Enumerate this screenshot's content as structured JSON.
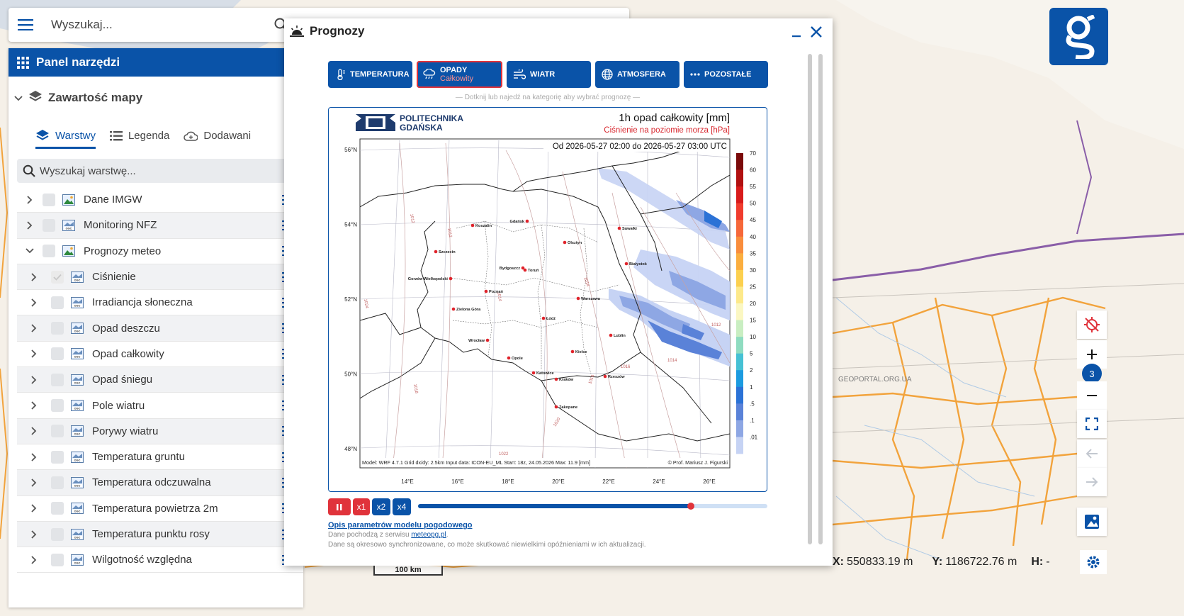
{
  "search": {
    "placeholder": "Wyszukaj..."
  },
  "tools_panel": {
    "title": "Panel narzędzi",
    "section_title": "Zawartość mapy",
    "tabs": [
      {
        "label": "Warstwy",
        "active": true
      },
      {
        "label": "Legenda",
        "active": false
      },
      {
        "label": "Dodawani",
        "active": false
      }
    ],
    "layer_search_placeholder": "Wyszukaj warstwę...",
    "layers": [
      {
        "name": "Dane IMGW",
        "level": 0
      },
      {
        "name": "Monitoring NFZ",
        "level": 0
      },
      {
        "name": "Prognozy meteo",
        "level": 0,
        "expanded": true
      },
      {
        "name": "Ciśnienie",
        "level": 1
      },
      {
        "name": "Irradiancja słoneczna",
        "level": 1
      },
      {
        "name": "Opad deszczu",
        "level": 1
      },
      {
        "name": "Opad całkowity",
        "level": 1
      },
      {
        "name": "Opad śniegu",
        "level": 1
      },
      {
        "name": "Pole wiatru",
        "level": 1
      },
      {
        "name": "Porywy wiatru",
        "level": 1
      },
      {
        "name": "Temperatura gruntu",
        "level": 1
      },
      {
        "name": "Temperatura odczuwalna",
        "level": 1
      },
      {
        "name": "Temperatura powietrza 2m",
        "level": 1
      },
      {
        "name": "Temperatura punktu rosy",
        "level": 1
      },
      {
        "name": "Wilgotność względna",
        "level": 1
      }
    ]
  },
  "dialog": {
    "title": "Prognozy",
    "categories": [
      {
        "label": "TEMPERATURA",
        "sub": "",
        "icon": "thermometer-icon"
      },
      {
        "label": "OPADY",
        "sub": "Całkowity",
        "icon": "rain-cloud-icon",
        "selected": true
      },
      {
        "label": "WIATR",
        "sub": "",
        "icon": "wind-icon"
      },
      {
        "label": "ATMOSFERA",
        "sub": "",
        "icon": "globe-icon"
      },
      {
        "label": "POZOSTAŁE",
        "sub": "",
        "icon": "dots-icon"
      }
    ],
    "hint": "— Dotknij lub najedź na kategorię aby wybrać prognozę —",
    "forecast_map": {
      "brand_line1": "POLITECHNIKA",
      "brand_line2": "GDAŃSKA",
      "title": "1h opad całkowity [mm]",
      "subtitle": "Ciśnienie na poziomie morza [hPa]",
      "period": "Od 2026-05-27 02:00 do 2026-05-27 03:00 UTC",
      "footer_model": "Model: WRF 4.7.1 Grid dx/dy: 2.5km Input data: ICON-EU_ML Start: 18z, 24.05.2026 Max: 11.9 [mm]",
      "footer_author": "© Prof. Mariusz J. Figurski",
      "lat_labels": [
        "56°N",
        "54°N",
        "52°N",
        "50°N",
        "48°N"
      ],
      "lon_labels": [
        "14°E",
        "16°E",
        "18°E",
        "20°E",
        "22°E",
        "24°E",
        "26°E"
      ],
      "scale_labels": [
        "70",
        "60",
        "55",
        "50",
        "45",
        "40",
        "35",
        "30",
        "25",
        "20",
        "15",
        "10",
        "5",
        "2",
        "1",
        ".5",
        ".1",
        ".01"
      ],
      "scale_colors": [
        "#7a0a0a",
        "#b11010",
        "#d81b1b",
        "#f03c2e",
        "#f6683a",
        "#f98d3c",
        "#fbae3f",
        "#fcd04f",
        "#fde98a",
        "#fbf7c2",
        "#c9eec2",
        "#8fdcc0",
        "#46c1d4",
        "#1c9be0",
        "#2b72d6",
        "#5a82d8",
        "#8ea7e4",
        "#c6d3f4"
      ],
      "cities": [
        "Koszalin",
        "Gdańsk",
        "Suwałki",
        "Olsztyn",
        "Szczecin",
        "Bydgoszcz",
        "Toruń",
        "Białystok",
        "Gorzów Wielkopolski",
        "Poznań",
        "Warszawa",
        "Zielona Góra",
        "Łódź",
        "Lublin",
        "Wrocław",
        "Kielce",
        "Opole",
        "Katowice",
        "Kraków",
        "Rzeszów",
        "Zakopane"
      ],
      "isobars": [
        "1012",
        "1012",
        "1014",
        "1014",
        "1016",
        "1012",
        "1014",
        "1016",
        "1018",
        "1020",
        "1022",
        "1024"
      ]
    },
    "controls": [
      {
        "label": "II",
        "color": "red"
      },
      {
        "label": "x1",
        "color": "red"
      },
      {
        "label": "x2",
        "color": "blue"
      },
      {
        "label": "x4",
        "color": "blue"
      }
    ],
    "progress": 0.78,
    "footer_link": "Opis parametrów modelu pogodowego",
    "footer_source_prefix": "Dane pochodzą z serwisu ",
    "footer_source_link": "meteopg.pl",
    "footer_source_suffix": ".",
    "footer_note": "Dane są okresowo synchronizowane, co może skutkować niewielkimi opóźnieniami w ich aktualizacji."
  },
  "map_controls": {
    "zoom_level": "3"
  },
  "basemap": {
    "watermark": "GEOPORTAL.ORG.UA",
    "scale_label": "100 km"
  },
  "status": {
    "x_label": "X:",
    "x_value": "550833.19 m",
    "y_label": "Y:",
    "y_value": "1186722.76 m",
    "h_label": "H:",
    "h_value": "-"
  },
  "colors": {
    "primary": "#0a53a8",
    "accent_red": "#e0333b"
  }
}
